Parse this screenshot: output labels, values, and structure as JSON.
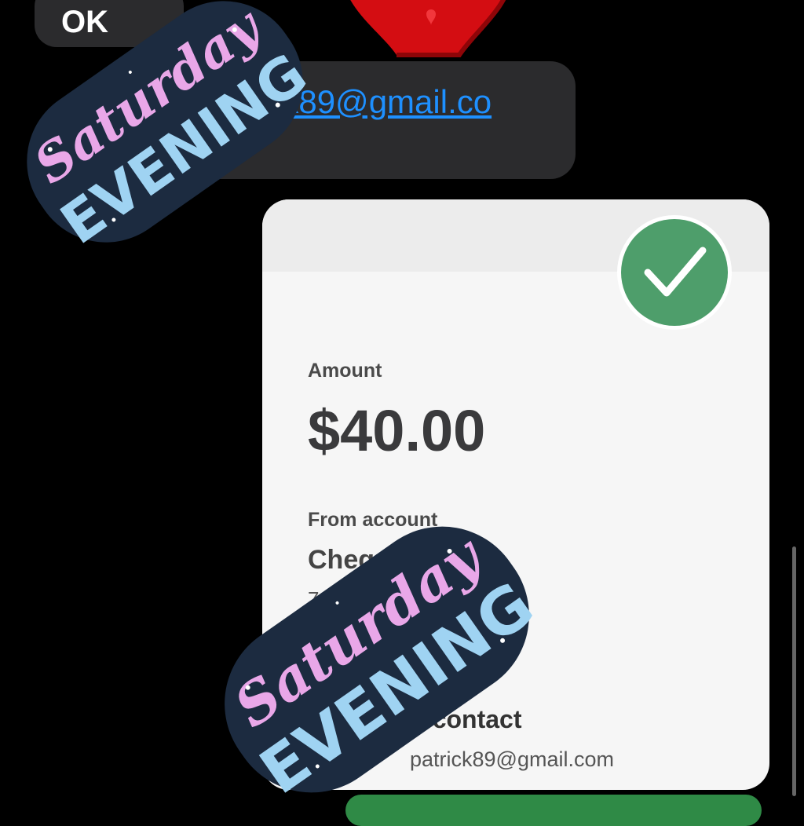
{
  "chat": {
    "top_bubble_text": "OK",
    "email_link": "atrick89@gmail.co"
  },
  "payment_card": {
    "amount_label": "Amount",
    "amount_value": "$40.00",
    "from_label": "From account",
    "from_account": "Chequing",
    "account_number": "73",
    "to_label": "e contact",
    "to_email": "patrick89@gmail.com",
    "status_icon": "checkmark-icon"
  },
  "stickers": {
    "line1": "Saturday",
    "line2": "EVENING"
  },
  "colors": {
    "link": "#1e90ff",
    "success_green": "#4e9e6b",
    "button_green": "#2f8a46",
    "sticker_pink": "#e9a7e8",
    "sticker_blue": "#9fd3f2",
    "sticker_navy": "#1c2b40"
  }
}
